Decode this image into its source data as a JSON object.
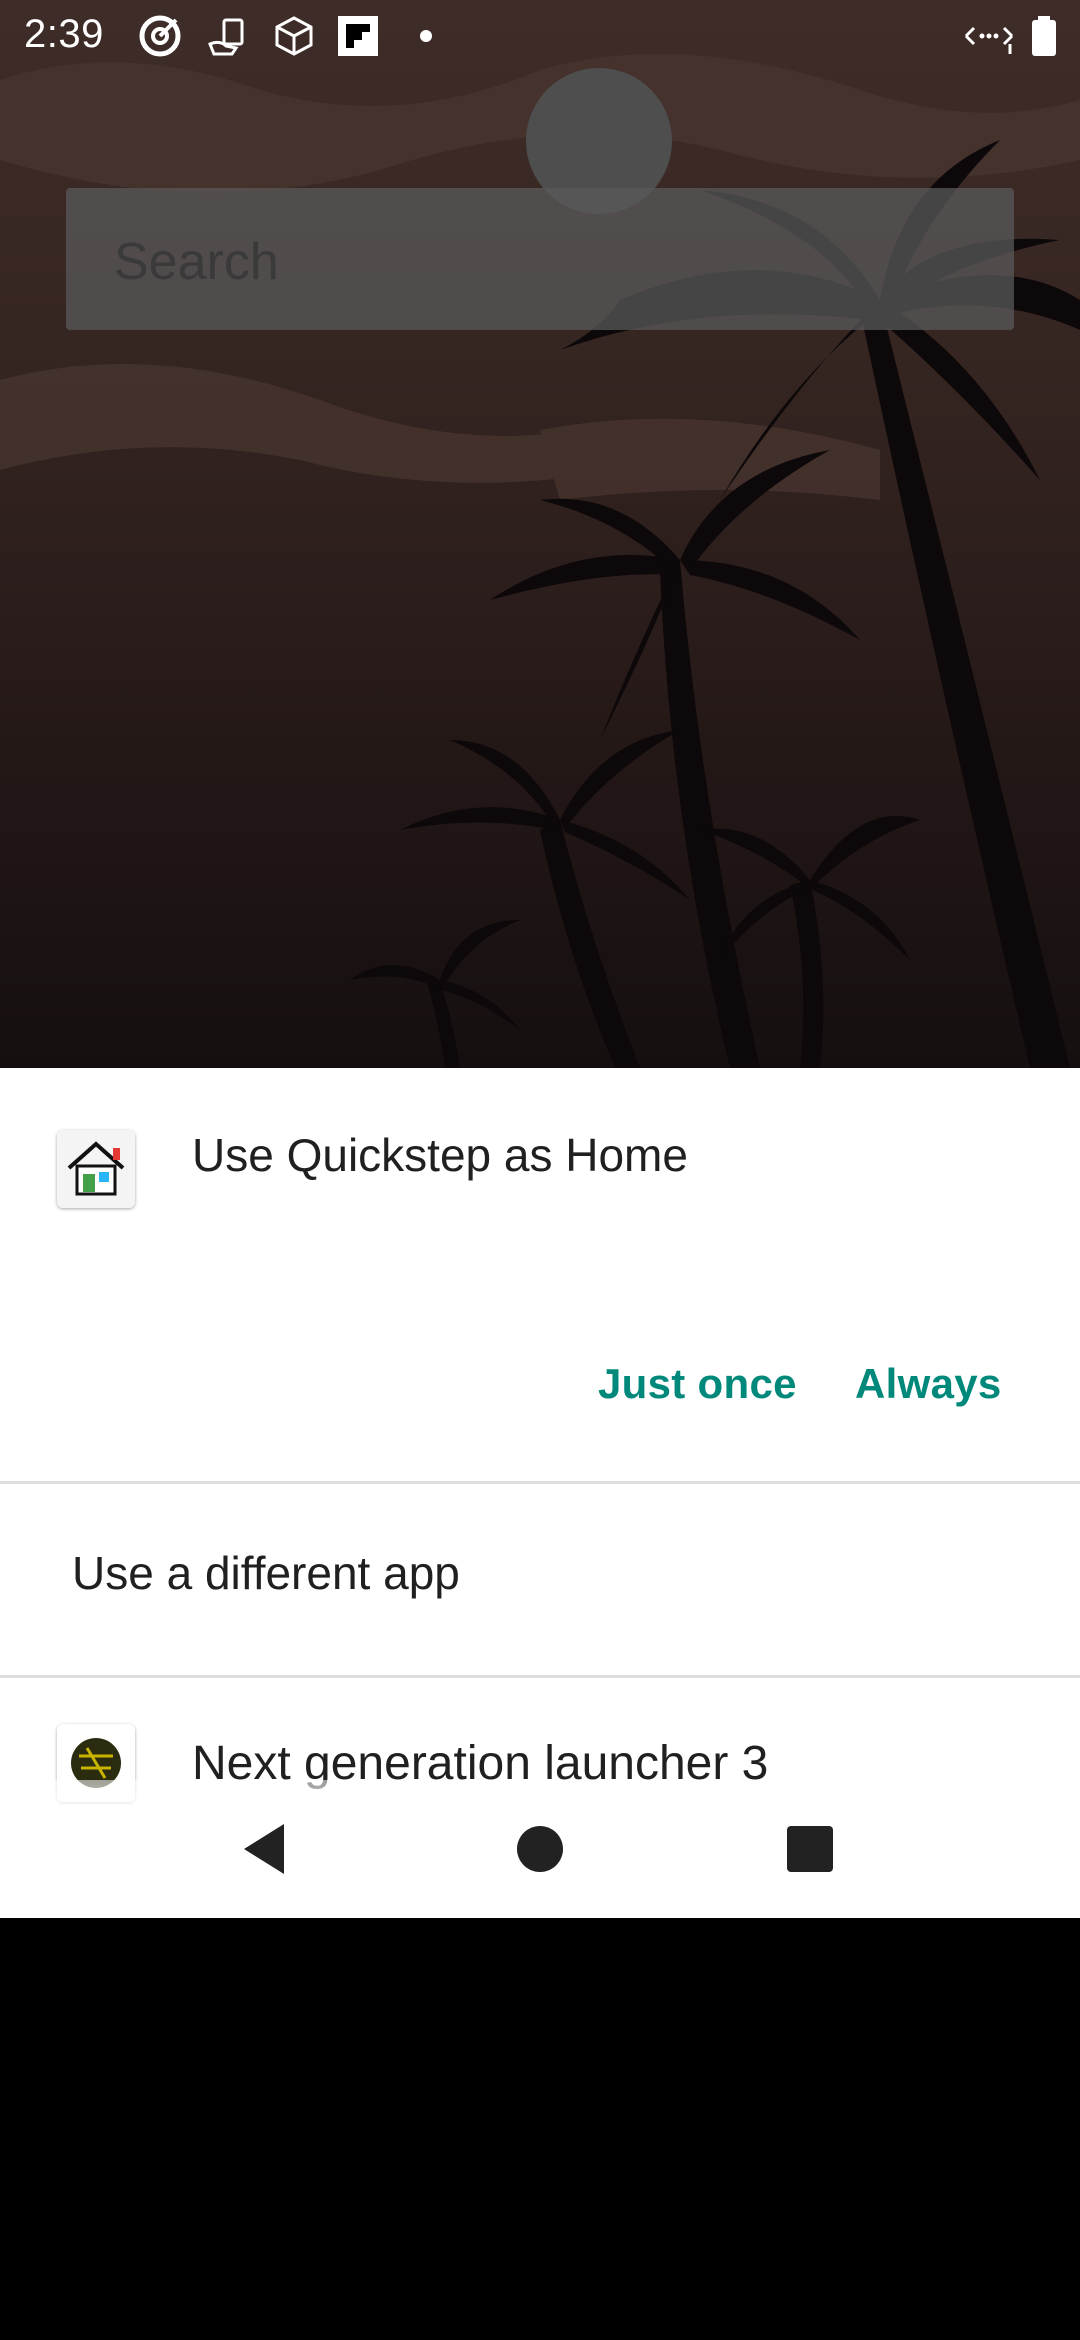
{
  "status_bar": {
    "time": "2:39",
    "icons": [
      "target-icon",
      "hand-card-icon",
      "cube-icon",
      "flipboard-icon",
      "dot-icon"
    ],
    "right_icons": [
      "data-arrows-icon",
      "battery-icon"
    ]
  },
  "home": {
    "search_placeholder": "Search"
  },
  "dialog": {
    "title": "Use Quickstep as Home",
    "just_once": "Just once",
    "always": "Always",
    "different_app": "Use a different app",
    "apps": [
      {
        "label": "Next generation launcher 3"
      }
    ]
  },
  "colors": {
    "accent": "#00897b",
    "sheet_bg": "#ffffff"
  }
}
